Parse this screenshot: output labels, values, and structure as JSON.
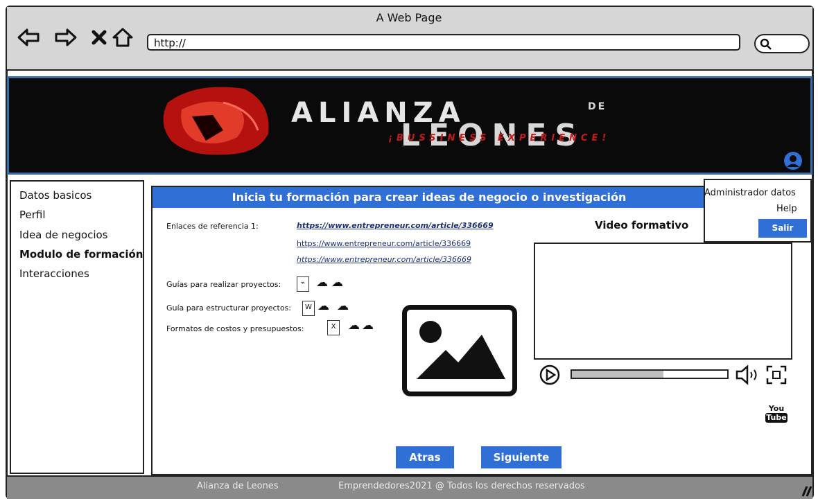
{
  "window": {
    "title": "A Web Page",
    "url": "http://"
  },
  "banner": {
    "line1": "ALIANZA",
    "de": "DE",
    "line2": "LEONES",
    "tagline": "¡BUSSINESS EXPERIENCE!"
  },
  "sidebar": {
    "items": [
      {
        "label": "Datos basicos"
      },
      {
        "label": "Perfil"
      },
      {
        "label": "Idea de negocios"
      },
      {
        "label": "Modulo de formación"
      },
      {
        "label": "Interacciones"
      }
    ]
  },
  "main": {
    "header": "Inicia tu formación para crear ideas de negocio o investigación",
    "links_label": "Enlaces de referencia 1:",
    "links": [
      "https://www.entrepreneur.com/article/336669",
      "https://www.entrepreneur.com/article/336669",
      "https://www.entrepreneur.com/article/336669"
    ],
    "guides_label": "Guías para realizar proyectos:",
    "structure_label": "Guía para estructurar proyectos:",
    "costs_label": "Formatos de costos y presupuestos:",
    "video_title": "Video formativo",
    "video_progress": 0.59,
    "back_button": "Atras",
    "next_button": "Siguiente"
  },
  "admin": {
    "title": "Administrador datos",
    "help": "Help",
    "logout": "Salir"
  },
  "footer": {
    "brand": "Alianza de Leones",
    "copyright": "Emprendedores2021 @  Todos los derechos reservados"
  },
  "youtube": {
    "line1": "You",
    "line2": "Tube"
  },
  "icons": {
    "back": "arrow-left-icon",
    "forward": "arrow-right-icon",
    "stop": "close-icon",
    "home": "home-icon",
    "search": "search-icon",
    "user": "user-icon",
    "pdf": "pdf-icon",
    "word": "word-icon",
    "excel": "excel-icon",
    "download": "cloud-download-icon",
    "play": "play-icon",
    "volume": "volume-icon",
    "fullscreen": "fullscreen-icon",
    "image": "image-icon",
    "youtube": "youtube-icon"
  },
  "colors": {
    "accent": "#2f6fd6",
    "banner_bg": "#0a0a0a",
    "tagline": "#c51a1a"
  }
}
